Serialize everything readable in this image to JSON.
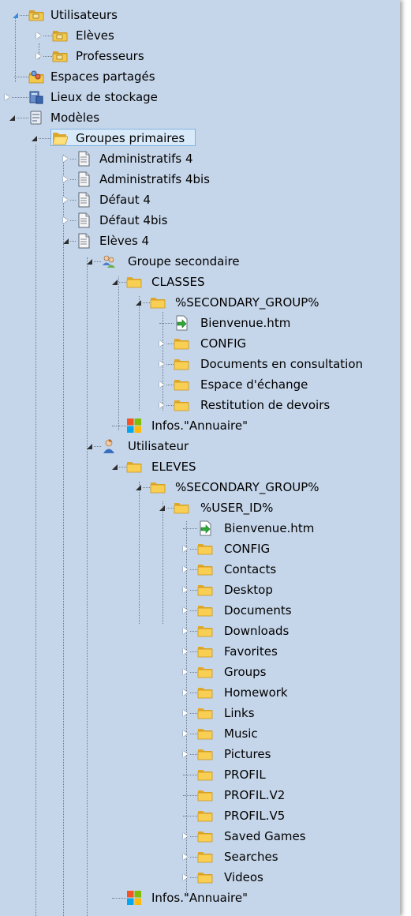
{
  "tree": {
    "nodes": [
      {
        "label": "Utilisateurs",
        "icon": "users-folder-icon",
        "expander": "expanded-blue"
      },
      {
        "label": "Elèves",
        "icon": "users-folder-icon",
        "expander": "collapsed"
      },
      {
        "label": "Professeurs",
        "icon": "users-folder-icon",
        "expander": "collapsed"
      },
      {
        "label": "Espaces partagés",
        "icon": "shared-spaces-icon",
        "expander": "none"
      },
      {
        "label": "Lieux de stockage",
        "icon": "storage-icon",
        "expander": "collapsed"
      },
      {
        "label": "Modèles",
        "icon": "templates-icon",
        "expander": "expanded"
      },
      {
        "label": "Groupes primaires",
        "icon": "folder-open-icon",
        "expander": "expanded",
        "selected": true
      },
      {
        "label": "Administratifs 4",
        "icon": "document-icon",
        "expander": "collapsed"
      },
      {
        "label": "Administratifs 4bis",
        "icon": "document-icon",
        "expander": "collapsed"
      },
      {
        "label": "Défaut 4",
        "icon": "document-icon",
        "expander": "collapsed"
      },
      {
        "label": "Défaut 4bis",
        "icon": "document-icon",
        "expander": "collapsed"
      },
      {
        "label": "Elèves 4",
        "icon": "document-icon",
        "expander": "expanded"
      },
      {
        "label": "Groupe secondaire",
        "icon": "group-icon",
        "expander": "expanded"
      },
      {
        "label": "CLASSES",
        "icon": "folder-icon",
        "expander": "expanded"
      },
      {
        "label": "%SECONDARY_GROUP%",
        "icon": "folder-icon",
        "expander": "expanded"
      },
      {
        "label": "Bienvenue.htm",
        "icon": "html-file-icon",
        "expander": "none"
      },
      {
        "label": "CONFIG",
        "icon": "folder-icon",
        "expander": "collapsed"
      },
      {
        "label": "Documents en consultation",
        "icon": "folder-icon",
        "expander": "collapsed"
      },
      {
        "label": "Espace d'échange",
        "icon": "folder-icon",
        "expander": "collapsed"
      },
      {
        "label": "Restitution de devoirs",
        "icon": "folder-icon",
        "expander": "collapsed"
      },
      {
        "label": "Infos.\"Annuaire\"",
        "icon": "windows-logo-icon",
        "expander": "none"
      },
      {
        "label": "Utilisateur",
        "icon": "user-icon",
        "expander": "expanded"
      },
      {
        "label": "ELEVES",
        "icon": "folder-icon",
        "expander": "expanded"
      },
      {
        "label": "%SECONDARY_GROUP%",
        "icon": "folder-icon",
        "expander": "expanded"
      },
      {
        "label": "%USER_ID%",
        "icon": "folder-icon",
        "expander": "expanded"
      },
      {
        "label": "Bienvenue.htm",
        "icon": "html-file-icon",
        "expander": "none"
      },
      {
        "label": "CONFIG",
        "icon": "folder-icon",
        "expander": "collapsed"
      },
      {
        "label": "Contacts",
        "icon": "folder-icon",
        "expander": "collapsed"
      },
      {
        "label": "Desktop",
        "icon": "folder-icon",
        "expander": "collapsed"
      },
      {
        "label": "Documents",
        "icon": "folder-icon",
        "expander": "collapsed"
      },
      {
        "label": "Downloads",
        "icon": "folder-icon",
        "expander": "collapsed"
      },
      {
        "label": "Favorites",
        "icon": "folder-icon",
        "expander": "collapsed"
      },
      {
        "label": "Groups",
        "icon": "folder-icon",
        "expander": "collapsed"
      },
      {
        "label": "Homework",
        "icon": "folder-icon",
        "expander": "collapsed"
      },
      {
        "label": "Links",
        "icon": "folder-icon",
        "expander": "collapsed"
      },
      {
        "label": "Music",
        "icon": "folder-icon",
        "expander": "collapsed"
      },
      {
        "label": "Pictures",
        "icon": "folder-icon",
        "expander": "collapsed"
      },
      {
        "label": "PROFIL",
        "icon": "folder-icon",
        "expander": "none"
      },
      {
        "label": "PROFIL.V2",
        "icon": "folder-icon",
        "expander": "none"
      },
      {
        "label": "PROFIL.V5",
        "icon": "folder-icon",
        "expander": "none"
      },
      {
        "label": "Saved Games",
        "icon": "folder-icon",
        "expander": "collapsed"
      },
      {
        "label": "Searches",
        "icon": "folder-icon",
        "expander": "collapsed"
      },
      {
        "label": "Videos",
        "icon": "folder-icon",
        "expander": "collapsed"
      },
      {
        "label": "Infos.\"Annuaire\"",
        "icon": "windows-logo-icon",
        "expander": "none"
      }
    ]
  }
}
